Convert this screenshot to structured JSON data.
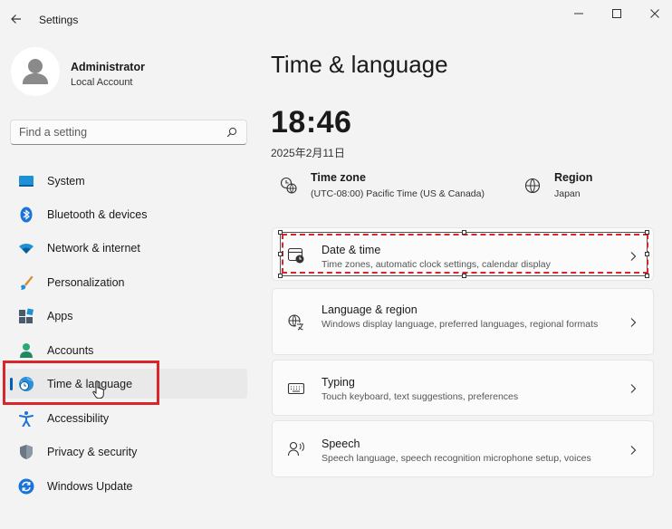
{
  "window": {
    "title": "Settings"
  },
  "account": {
    "name": "Administrator",
    "type": "Local Account"
  },
  "search": {
    "placeholder": "Find a setting"
  },
  "sidebar": {
    "items": [
      {
        "label": "System",
        "icon": "system-icon",
        "selected": false
      },
      {
        "label": "Bluetooth & devices",
        "icon": "bluetooth-icon",
        "selected": false
      },
      {
        "label": "Network & internet",
        "icon": "wifi-icon",
        "selected": false
      },
      {
        "label": "Personalization",
        "icon": "brush-icon",
        "selected": false
      },
      {
        "label": "Apps",
        "icon": "apps-icon",
        "selected": false
      },
      {
        "label": "Accounts",
        "icon": "person-icon",
        "selected": false
      },
      {
        "label": "Time & language",
        "icon": "globe-clock-icon",
        "selected": true
      },
      {
        "label": "Accessibility",
        "icon": "accessibility-icon",
        "selected": false
      },
      {
        "label": "Privacy & security",
        "icon": "shield-icon",
        "selected": false
      },
      {
        "label": "Windows Update",
        "icon": "update-icon",
        "selected": false
      }
    ]
  },
  "main": {
    "title": "Time & language",
    "clock": "18:46",
    "date": "2025年2月11日",
    "time_zone": {
      "title": "Time zone",
      "value": "(UTC-08:00) Pacific Time (US & Canada)"
    },
    "region": {
      "title": "Region",
      "value": "Japan"
    },
    "cards": [
      {
        "title": "Date & time",
        "subtitle": "Time zones, automatic clock settings, calendar display",
        "icon": "calendar-clock-icon"
      },
      {
        "title": "Language & region",
        "subtitle": "Windows display language, preferred languages, regional formats",
        "icon": "language-icon"
      },
      {
        "title": "Typing",
        "subtitle": "Touch keyboard, text suggestions, preferences",
        "icon": "keyboard-icon"
      },
      {
        "title": "Speech",
        "subtitle": "Speech language, speech recognition microphone setup, voices",
        "icon": "speech-icon"
      }
    ]
  },
  "colors": {
    "accent": "#005fb8",
    "annotation_red": "#d9262a",
    "background": "#f3f3f3"
  }
}
